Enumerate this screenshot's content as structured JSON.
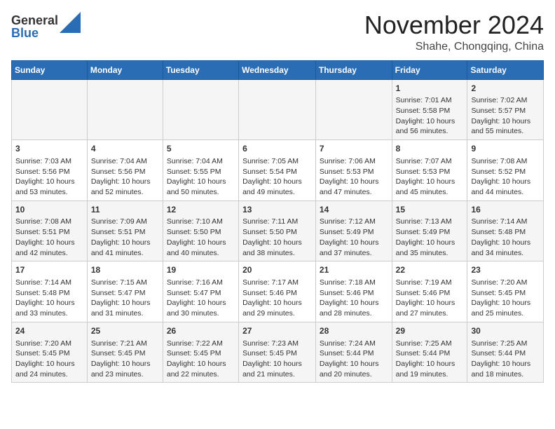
{
  "header": {
    "logo": {
      "general": "General",
      "blue": "Blue"
    },
    "title": "November 2024",
    "subtitle": "Shahe, Chongqing, China"
  },
  "weekdays": [
    "Sunday",
    "Monday",
    "Tuesday",
    "Wednesday",
    "Thursday",
    "Friday",
    "Saturday"
  ],
  "weeks": [
    [
      {
        "day": "",
        "info": ""
      },
      {
        "day": "",
        "info": ""
      },
      {
        "day": "",
        "info": ""
      },
      {
        "day": "",
        "info": ""
      },
      {
        "day": "",
        "info": ""
      },
      {
        "day": "1",
        "info": "Sunrise: 7:01 AM\nSunset: 5:58 PM\nDaylight: 10 hours and 56 minutes."
      },
      {
        "day": "2",
        "info": "Sunrise: 7:02 AM\nSunset: 5:57 PM\nDaylight: 10 hours and 55 minutes."
      }
    ],
    [
      {
        "day": "3",
        "info": "Sunrise: 7:03 AM\nSunset: 5:56 PM\nDaylight: 10 hours and 53 minutes."
      },
      {
        "day": "4",
        "info": "Sunrise: 7:04 AM\nSunset: 5:56 PM\nDaylight: 10 hours and 52 minutes."
      },
      {
        "day": "5",
        "info": "Sunrise: 7:04 AM\nSunset: 5:55 PM\nDaylight: 10 hours and 50 minutes."
      },
      {
        "day": "6",
        "info": "Sunrise: 7:05 AM\nSunset: 5:54 PM\nDaylight: 10 hours and 49 minutes."
      },
      {
        "day": "7",
        "info": "Sunrise: 7:06 AM\nSunset: 5:53 PM\nDaylight: 10 hours and 47 minutes."
      },
      {
        "day": "8",
        "info": "Sunrise: 7:07 AM\nSunset: 5:53 PM\nDaylight: 10 hours and 45 minutes."
      },
      {
        "day": "9",
        "info": "Sunrise: 7:08 AM\nSunset: 5:52 PM\nDaylight: 10 hours and 44 minutes."
      }
    ],
    [
      {
        "day": "10",
        "info": "Sunrise: 7:08 AM\nSunset: 5:51 PM\nDaylight: 10 hours and 42 minutes."
      },
      {
        "day": "11",
        "info": "Sunrise: 7:09 AM\nSunset: 5:51 PM\nDaylight: 10 hours and 41 minutes."
      },
      {
        "day": "12",
        "info": "Sunrise: 7:10 AM\nSunset: 5:50 PM\nDaylight: 10 hours and 40 minutes."
      },
      {
        "day": "13",
        "info": "Sunrise: 7:11 AM\nSunset: 5:50 PM\nDaylight: 10 hours and 38 minutes."
      },
      {
        "day": "14",
        "info": "Sunrise: 7:12 AM\nSunset: 5:49 PM\nDaylight: 10 hours and 37 minutes."
      },
      {
        "day": "15",
        "info": "Sunrise: 7:13 AM\nSunset: 5:49 PM\nDaylight: 10 hours and 35 minutes."
      },
      {
        "day": "16",
        "info": "Sunrise: 7:14 AM\nSunset: 5:48 PM\nDaylight: 10 hours and 34 minutes."
      }
    ],
    [
      {
        "day": "17",
        "info": "Sunrise: 7:14 AM\nSunset: 5:48 PM\nDaylight: 10 hours and 33 minutes."
      },
      {
        "day": "18",
        "info": "Sunrise: 7:15 AM\nSunset: 5:47 PM\nDaylight: 10 hours and 31 minutes."
      },
      {
        "day": "19",
        "info": "Sunrise: 7:16 AM\nSunset: 5:47 PM\nDaylight: 10 hours and 30 minutes."
      },
      {
        "day": "20",
        "info": "Sunrise: 7:17 AM\nSunset: 5:46 PM\nDaylight: 10 hours and 29 minutes."
      },
      {
        "day": "21",
        "info": "Sunrise: 7:18 AM\nSunset: 5:46 PM\nDaylight: 10 hours and 28 minutes."
      },
      {
        "day": "22",
        "info": "Sunrise: 7:19 AM\nSunset: 5:46 PM\nDaylight: 10 hours and 27 minutes."
      },
      {
        "day": "23",
        "info": "Sunrise: 7:20 AM\nSunset: 5:45 PM\nDaylight: 10 hours and 25 minutes."
      }
    ],
    [
      {
        "day": "24",
        "info": "Sunrise: 7:20 AM\nSunset: 5:45 PM\nDaylight: 10 hours and 24 minutes."
      },
      {
        "day": "25",
        "info": "Sunrise: 7:21 AM\nSunset: 5:45 PM\nDaylight: 10 hours and 23 minutes."
      },
      {
        "day": "26",
        "info": "Sunrise: 7:22 AM\nSunset: 5:45 PM\nDaylight: 10 hours and 22 minutes."
      },
      {
        "day": "27",
        "info": "Sunrise: 7:23 AM\nSunset: 5:45 PM\nDaylight: 10 hours and 21 minutes."
      },
      {
        "day": "28",
        "info": "Sunrise: 7:24 AM\nSunset: 5:44 PM\nDaylight: 10 hours and 20 minutes."
      },
      {
        "day": "29",
        "info": "Sunrise: 7:25 AM\nSunset: 5:44 PM\nDaylight: 10 hours and 19 minutes."
      },
      {
        "day": "30",
        "info": "Sunrise: 7:25 AM\nSunset: 5:44 PM\nDaylight: 10 hours and 18 minutes."
      }
    ]
  ]
}
